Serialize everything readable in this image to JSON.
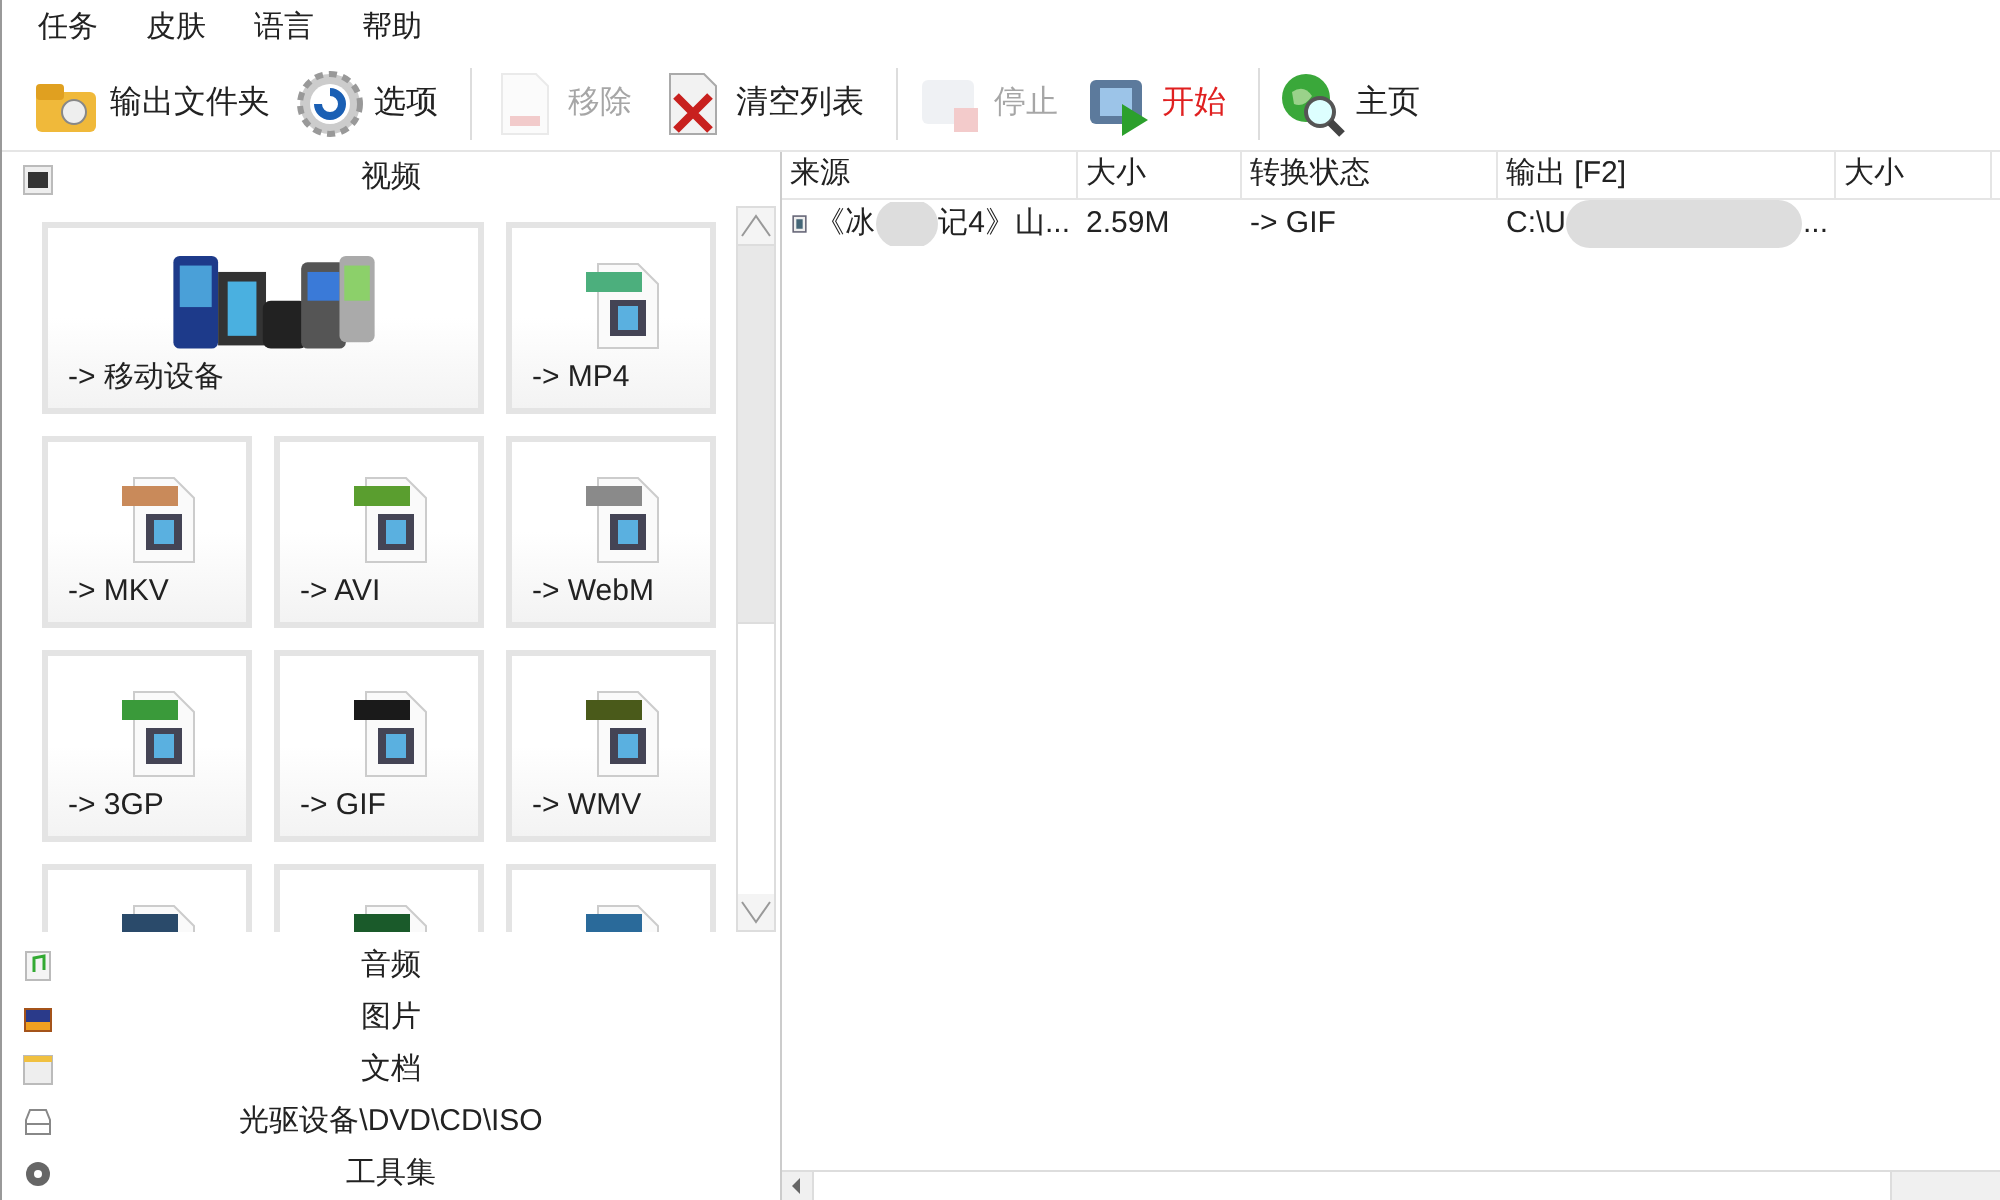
{
  "menu": [
    "任务",
    "皮肤",
    "语言",
    "帮助"
  ],
  "toolbar": [
    {
      "label": "输出文件夹",
      "kind": "folder",
      "disabled": false,
      "accent": false
    },
    {
      "label": "选项",
      "kind": "gear",
      "disabled": false,
      "accent": false
    },
    {
      "label": "移除",
      "kind": "remove",
      "disabled": true,
      "accent": false
    },
    {
      "label": "清空列表",
      "kind": "clear",
      "disabled": false,
      "accent": false
    },
    {
      "label": "停止",
      "kind": "stop",
      "disabled": true,
      "accent": false
    },
    {
      "label": "开始",
      "kind": "start",
      "disabled": false,
      "accent": true
    },
    {
      "label": "主页",
      "kind": "home",
      "disabled": false,
      "accent": false
    }
  ],
  "panel": {
    "title": "视频",
    "tiles": [
      {
        "label": "-> 移动设备",
        "kind": "devices",
        "wide": true
      },
      {
        "label": "-> MP4",
        "kind": "file",
        "color": "#4caf7d"
      },
      {
        "label": "-> MKV",
        "kind": "file",
        "color": "#c98a5a"
      },
      {
        "label": "-> AVI",
        "kind": "file",
        "color": "#5a9e2f"
      },
      {
        "label": "-> WebM",
        "kind": "file",
        "color": "#8a8a8a"
      },
      {
        "label": "-> 3GP",
        "kind": "file",
        "color": "#3a9a3a"
      },
      {
        "label": "-> GIF",
        "kind": "file",
        "color": "#1a1a1a"
      },
      {
        "label": "-> WMV",
        "kind": "file",
        "color": "#4a5a1a"
      },
      {
        "kind": "file",
        "color": "#2a4a6a"
      },
      {
        "kind": "file",
        "color": "#1a5a2a"
      },
      {
        "kind": "file",
        "color": "#2a6a9a"
      }
    ],
    "categories": [
      {
        "label": "音频",
        "kind": "audio"
      },
      {
        "label": "图片",
        "kind": "image"
      },
      {
        "label": "文档",
        "kind": "doc"
      },
      {
        "label": "光驱设备\\DVD\\CD\\ISO",
        "kind": "disc"
      },
      {
        "label": "工具集",
        "kind": "tools"
      }
    ]
  },
  "table": {
    "columns": [
      "来源",
      "大小",
      "转换状态",
      "输出 [F2]",
      "大小"
    ],
    "rows": [
      {
        "source": [
          "《冰",
          "记4》山..."
        ],
        "size": "2.59M",
        "status": "-> GIF",
        "output": [
          "C:\\U",
          "..."
        ]
      }
    ]
  }
}
